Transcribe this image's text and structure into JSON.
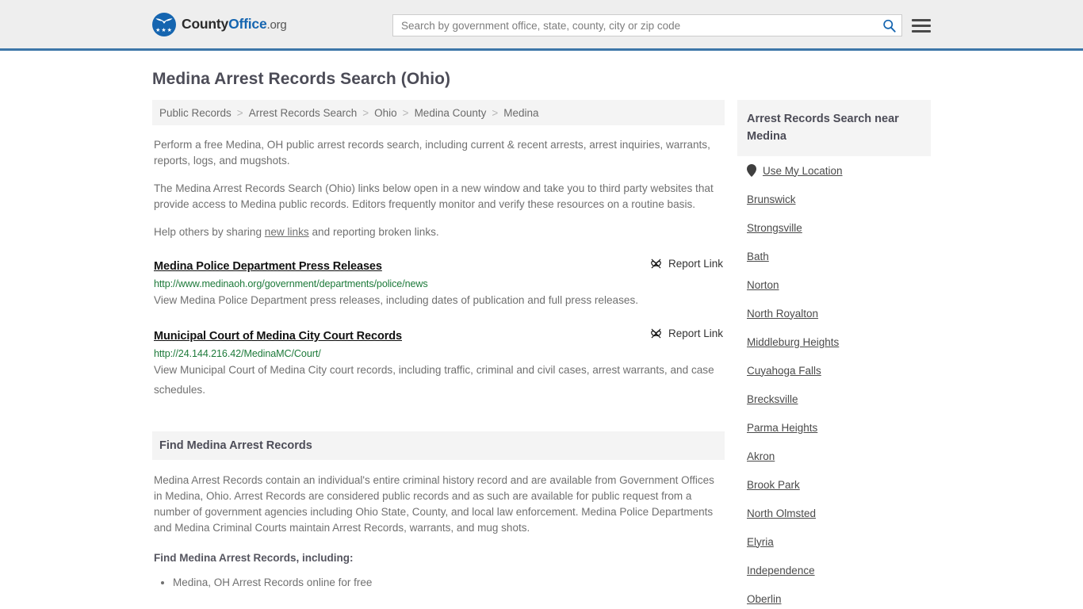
{
  "header": {
    "logo": {
      "text_1": "County",
      "text_2": "Office",
      "text_3": ".org",
      "icon": "eagle-shield-logo"
    },
    "search": {
      "placeholder": "Search by government office, state, county, city or zip code",
      "value": "",
      "icon": "search-icon",
      "accent": "#1565b0"
    },
    "menu_icon": "hamburger-menu-icon",
    "accent_border": "#3d76a8"
  },
  "page_title": "Medina Arrest Records Search (Ohio)",
  "breadcrumb": {
    "separator": ">",
    "items": [
      "Public Records",
      "Arrest Records Search",
      "Ohio",
      "Medina County",
      "Medina"
    ]
  },
  "intro": {
    "p1": "Perform a free Medina, OH public arrest records search, including current & recent arrests, arrest inquiries, warrants, reports, logs, and mugshots.",
    "p2": "The Medina Arrest Records Search (Ohio) links below open in a new window and take you to third party websites that provide access to Medina public records. Editors frequently monitor and verify these resources on a routine basis.",
    "p3_before": "Help others by sharing ",
    "p3_link": "new links",
    "p3_after": " and reporting broken links."
  },
  "results": [
    {
      "title": "Medina Police Department Press Releases",
      "url": "http://www.medinaoh.org/government/departments/police/news",
      "description": "View Medina Police Department press releases, including dates of publication and full press releases.",
      "report_label": "Report Link",
      "report_icon": "broken-link-icon"
    },
    {
      "title": "Municipal Court of Medina City Court Records",
      "url": "http://24.144.216.42/MedinaMC/Court/",
      "description": "View Municipal Court of Medina City court records, including traffic, criminal and civil cases, arrest warrants, and case schedules.",
      "report_label": "Report Link",
      "report_icon": "broken-link-icon"
    }
  ],
  "find_section": {
    "heading": "Find Medina Arrest Records",
    "body": "Medina Arrest Records contain an individual's entire criminal history record and are available from Government Offices in Medina, Ohio. Arrest Records are considered public records and as such are available for public request from a number of government agencies including Ohio State, County, and local law enforcement. Medina Police Departments and Medina Criminal Courts maintain Arrest Records, warrants, and mug shots.",
    "subheading": "Find Medina Arrest Records, including:",
    "bullets": [
      "Medina, OH Arrest Records online for free"
    ]
  },
  "sidebar": {
    "heading": "Arrest Records Search near Medina",
    "use_my_location": {
      "label": "Use My Location",
      "icon": "map-pin-icon"
    },
    "cities": [
      "Brunswick",
      "Strongsville",
      "Bath",
      "Norton",
      "North Royalton",
      "Middleburg Heights",
      "Cuyahoga Falls",
      "Brecksville",
      "Parma Heights",
      "Akron",
      "Brook Park",
      "North Olmsted",
      "Elyria",
      "Independence",
      "Oberlin"
    ]
  }
}
